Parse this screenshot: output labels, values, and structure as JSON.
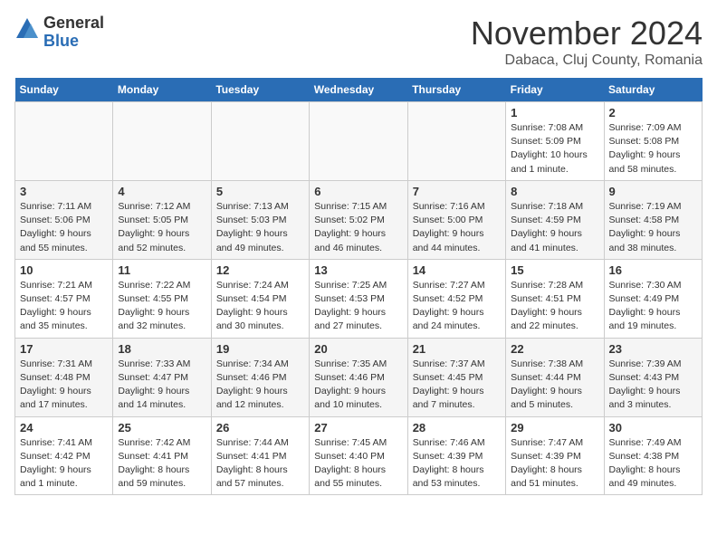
{
  "header": {
    "logo_general": "General",
    "logo_blue": "Blue",
    "month_title": "November 2024",
    "location": "Dabaca, Cluj County, Romania"
  },
  "weekdays": [
    "Sunday",
    "Monday",
    "Tuesday",
    "Wednesday",
    "Thursday",
    "Friday",
    "Saturday"
  ],
  "weeks": [
    [
      {
        "day": "",
        "detail": ""
      },
      {
        "day": "",
        "detail": ""
      },
      {
        "day": "",
        "detail": ""
      },
      {
        "day": "",
        "detail": ""
      },
      {
        "day": "",
        "detail": ""
      },
      {
        "day": "1",
        "detail": "Sunrise: 7:08 AM\nSunset: 5:09 PM\nDaylight: 10 hours\nand 1 minute."
      },
      {
        "day": "2",
        "detail": "Sunrise: 7:09 AM\nSunset: 5:08 PM\nDaylight: 9 hours\nand 58 minutes."
      }
    ],
    [
      {
        "day": "3",
        "detail": "Sunrise: 7:11 AM\nSunset: 5:06 PM\nDaylight: 9 hours\nand 55 minutes."
      },
      {
        "day": "4",
        "detail": "Sunrise: 7:12 AM\nSunset: 5:05 PM\nDaylight: 9 hours\nand 52 minutes."
      },
      {
        "day": "5",
        "detail": "Sunrise: 7:13 AM\nSunset: 5:03 PM\nDaylight: 9 hours\nand 49 minutes."
      },
      {
        "day": "6",
        "detail": "Sunrise: 7:15 AM\nSunset: 5:02 PM\nDaylight: 9 hours\nand 46 minutes."
      },
      {
        "day": "7",
        "detail": "Sunrise: 7:16 AM\nSunset: 5:00 PM\nDaylight: 9 hours\nand 44 minutes."
      },
      {
        "day": "8",
        "detail": "Sunrise: 7:18 AM\nSunset: 4:59 PM\nDaylight: 9 hours\nand 41 minutes."
      },
      {
        "day": "9",
        "detail": "Sunrise: 7:19 AM\nSunset: 4:58 PM\nDaylight: 9 hours\nand 38 minutes."
      }
    ],
    [
      {
        "day": "10",
        "detail": "Sunrise: 7:21 AM\nSunset: 4:57 PM\nDaylight: 9 hours\nand 35 minutes."
      },
      {
        "day": "11",
        "detail": "Sunrise: 7:22 AM\nSunset: 4:55 PM\nDaylight: 9 hours\nand 32 minutes."
      },
      {
        "day": "12",
        "detail": "Sunrise: 7:24 AM\nSunset: 4:54 PM\nDaylight: 9 hours\nand 30 minutes."
      },
      {
        "day": "13",
        "detail": "Sunrise: 7:25 AM\nSunset: 4:53 PM\nDaylight: 9 hours\nand 27 minutes."
      },
      {
        "day": "14",
        "detail": "Sunrise: 7:27 AM\nSunset: 4:52 PM\nDaylight: 9 hours\nand 24 minutes."
      },
      {
        "day": "15",
        "detail": "Sunrise: 7:28 AM\nSunset: 4:51 PM\nDaylight: 9 hours\nand 22 minutes."
      },
      {
        "day": "16",
        "detail": "Sunrise: 7:30 AM\nSunset: 4:49 PM\nDaylight: 9 hours\nand 19 minutes."
      }
    ],
    [
      {
        "day": "17",
        "detail": "Sunrise: 7:31 AM\nSunset: 4:48 PM\nDaylight: 9 hours\nand 17 minutes."
      },
      {
        "day": "18",
        "detail": "Sunrise: 7:33 AM\nSunset: 4:47 PM\nDaylight: 9 hours\nand 14 minutes."
      },
      {
        "day": "19",
        "detail": "Sunrise: 7:34 AM\nSunset: 4:46 PM\nDaylight: 9 hours\nand 12 minutes."
      },
      {
        "day": "20",
        "detail": "Sunrise: 7:35 AM\nSunset: 4:46 PM\nDaylight: 9 hours\nand 10 minutes."
      },
      {
        "day": "21",
        "detail": "Sunrise: 7:37 AM\nSunset: 4:45 PM\nDaylight: 9 hours\nand 7 minutes."
      },
      {
        "day": "22",
        "detail": "Sunrise: 7:38 AM\nSunset: 4:44 PM\nDaylight: 9 hours\nand 5 minutes."
      },
      {
        "day": "23",
        "detail": "Sunrise: 7:39 AM\nSunset: 4:43 PM\nDaylight: 9 hours\nand 3 minutes."
      }
    ],
    [
      {
        "day": "24",
        "detail": "Sunrise: 7:41 AM\nSunset: 4:42 PM\nDaylight: 9 hours\nand 1 minute."
      },
      {
        "day": "25",
        "detail": "Sunrise: 7:42 AM\nSunset: 4:41 PM\nDaylight: 8 hours\nand 59 minutes."
      },
      {
        "day": "26",
        "detail": "Sunrise: 7:44 AM\nSunset: 4:41 PM\nDaylight: 8 hours\nand 57 minutes."
      },
      {
        "day": "27",
        "detail": "Sunrise: 7:45 AM\nSunset: 4:40 PM\nDaylight: 8 hours\nand 55 minutes."
      },
      {
        "day": "28",
        "detail": "Sunrise: 7:46 AM\nSunset: 4:39 PM\nDaylight: 8 hours\nand 53 minutes."
      },
      {
        "day": "29",
        "detail": "Sunrise: 7:47 AM\nSunset: 4:39 PM\nDaylight: 8 hours\nand 51 minutes."
      },
      {
        "day": "30",
        "detail": "Sunrise: 7:49 AM\nSunset: 4:38 PM\nDaylight: 8 hours\nand 49 minutes."
      }
    ]
  ]
}
